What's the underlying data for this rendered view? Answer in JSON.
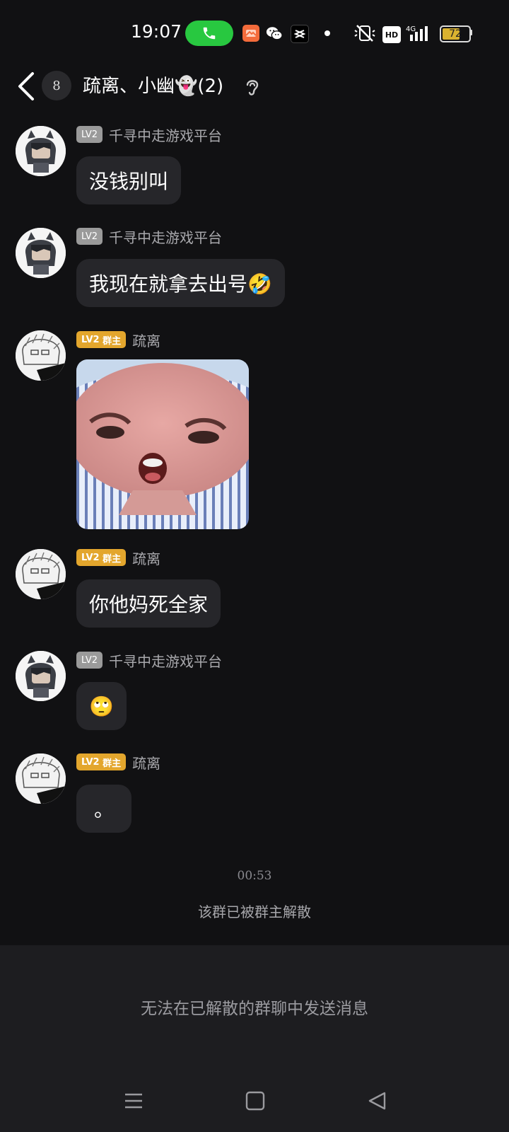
{
  "status_bar": {
    "time": "19:07",
    "battery": "72",
    "network": "4G"
  },
  "header": {
    "unread_count": "8",
    "title": "疏离、小幽👻(2)"
  },
  "messages": [
    {
      "level": "LV2",
      "role": "",
      "sender": "千寻中走游戏平台",
      "text": "没钱别叫"
    },
    {
      "level": "LV2",
      "role": "",
      "sender": "千寻中走游戏平台",
      "text": "我现在就拿去出号🤣"
    },
    {
      "level": "LV2",
      "role": "群主",
      "sender": "疏离",
      "text": ""
    },
    {
      "level": "LV2",
      "role": "群主",
      "sender": "疏离",
      "text": "你他妈死全家"
    },
    {
      "level": "LV2",
      "role": "",
      "sender": "千寻中走游戏平台",
      "text": "🙄"
    },
    {
      "level": "LV2",
      "role": "群主",
      "sender": "疏离",
      "text": "。"
    }
  ],
  "timestamp": "00:53",
  "system_message": "该群已被群主解散",
  "footer": {
    "disabled_notice": "无法在已解散的群聊中发送消息"
  },
  "colors": {
    "background": "#111113",
    "bubble": "#26262a",
    "owner_badge": "#e3a62d",
    "level_badge": "#9a9a9a",
    "call_green": "#28c840"
  },
  "icons": [
    "phone-icon",
    "wechat-icon",
    "capcut-icon",
    "mute-icon",
    "hd-icon",
    "signal-icon",
    "battery-icon",
    "back-icon",
    "ear-icon",
    "menu-icon",
    "home-icon",
    "back-nav-icon"
  ]
}
